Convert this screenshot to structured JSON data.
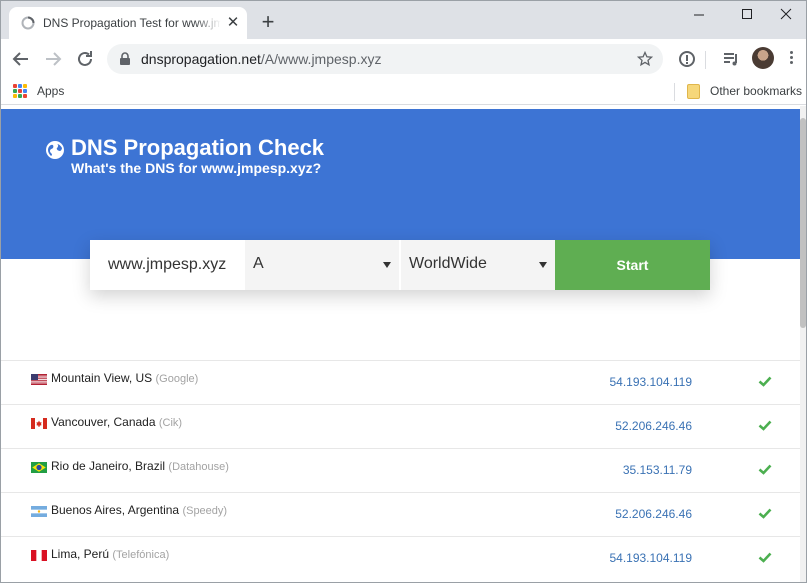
{
  "browser": {
    "tab_title": "DNS Propagation Test for www.jmpesp.xyz",
    "tab_close_glyph": "✕",
    "new_tab_glyph": "+",
    "url_host": "dnspropagation.net",
    "url_path": "/A/www.jmpesp.xyz",
    "icons": [
      "back-arrow-icon",
      "forward-arrow-icon",
      "reload-icon",
      "lock-icon",
      "star-icon",
      "info-icon",
      "media-queue-icon",
      "profile-avatar",
      "more-menu-icon"
    ]
  },
  "bookmarks": {
    "apps_label": "Apps",
    "other_label": "Other bookmarks"
  },
  "hero": {
    "title": "DNS Propagation Check",
    "subtitle": "What's the DNS for www.jmpesp.xyz?",
    "background_color": "#3d74d4"
  },
  "search": {
    "domain_value": "www.jmpesp.xyz",
    "record_type": "A",
    "region": "WorldWide",
    "start_label": "Start",
    "start_color": "#5fae52"
  },
  "results": [
    {
      "flag": "us",
      "location": "Mountain View, US",
      "provider": "(Google)",
      "ip": "54.193.104.119",
      "status": "ok"
    },
    {
      "flag": "ca",
      "location": "Vancouver, Canada",
      "provider": "(Cik)",
      "ip": "52.206.246.46",
      "status": "ok"
    },
    {
      "flag": "br",
      "location": "Rio de Janeiro, Brazil",
      "provider": "(Datahouse)",
      "ip": "35.153.11.79",
      "status": "ok"
    },
    {
      "flag": "ar",
      "location": "Buenos Aires, Argentina",
      "provider": "(Speedy)",
      "ip": "52.206.246.46",
      "status": "ok"
    },
    {
      "flag": "pe",
      "location": "Lima, Perú",
      "provider": "(Telefónica)",
      "ip": "54.193.104.119",
      "status": "ok"
    }
  ],
  "colors": {
    "ip_link": "#3a72b4",
    "check": "#4caf50"
  }
}
